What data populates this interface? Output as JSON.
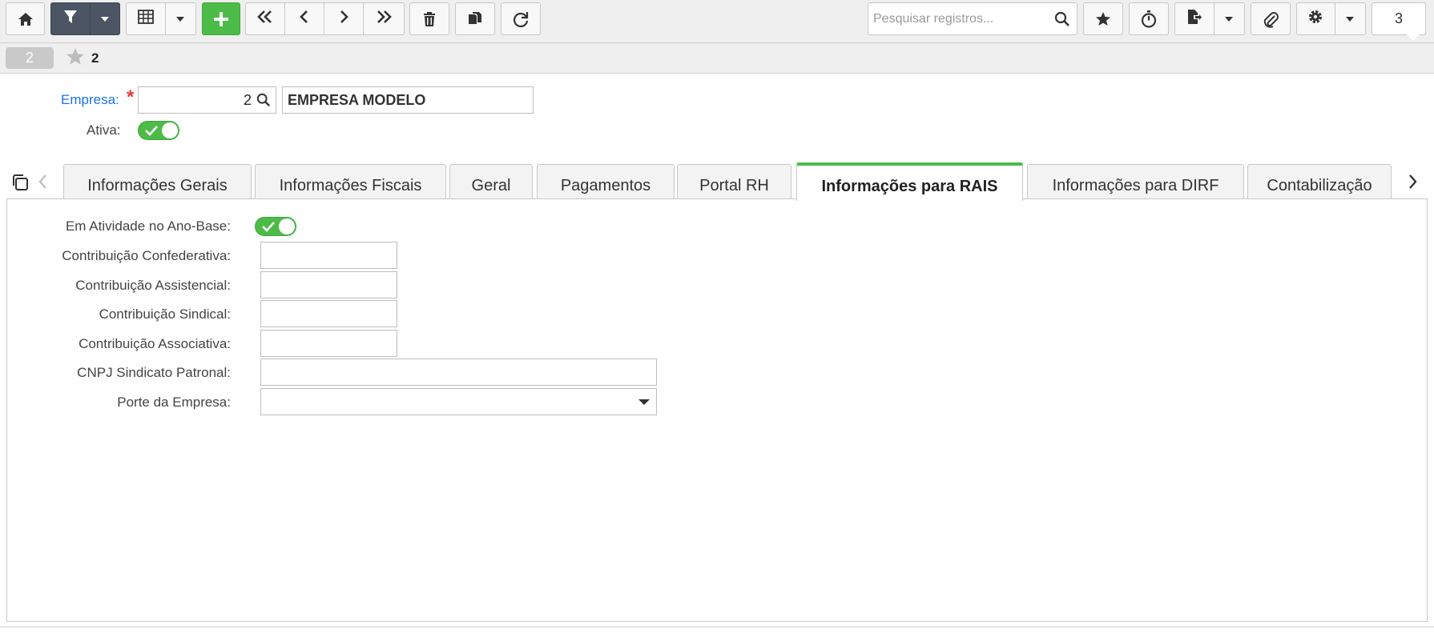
{
  "toolbar": {
    "search_placeholder": "Pesquisar registros...",
    "record_counter": "3",
    "icons": [
      "home-icon",
      "filter-icon",
      "grid-icon",
      "plus-icon",
      "first-icon",
      "prev-icon",
      "next-icon",
      "last-icon",
      "trash-icon",
      "copy-icon",
      "refresh-icon",
      "search-icon",
      "star-icon",
      "stopwatch-icon",
      "export-icon",
      "paperclip-icon",
      "gear-icon"
    ]
  },
  "breadcrumb": {
    "record_number": "2",
    "label": "2"
  },
  "header": {
    "empresa_label": "Empresa:",
    "empresa_code": "2",
    "empresa_name": "EMPRESA MODELO",
    "ativa_label": "Ativa:",
    "ativa_on": true
  },
  "tabs": [
    {
      "label": "Informações Gerais",
      "active": false
    },
    {
      "label": "Informações Fiscais",
      "active": false
    },
    {
      "label": "Geral",
      "active": false
    },
    {
      "label": "Pagamentos",
      "active": false
    },
    {
      "label": "Portal RH",
      "active": false
    },
    {
      "label": "Informações para RAIS",
      "active": true
    },
    {
      "label": "Informações para DIRF",
      "active": false
    },
    {
      "label": "Contabilização",
      "active": false
    }
  ],
  "rais": {
    "em_atividade_label": "Em Atividade no Ano-Base:",
    "em_atividade_on": true,
    "confederativa_label": "Contribuição Confederativa:",
    "confederativa_value": "",
    "assistencial_label": "Contribuição Assistencial:",
    "assistencial_value": "",
    "sindical_label": "Contribuição Sindical:",
    "sindical_value": "",
    "associativa_label": "Contribuição Associativa:",
    "associativa_value": "",
    "cnpj_label": "CNPJ Sindicato Patronal:",
    "cnpj_value": "",
    "porte_label": "Porte da Empresa:",
    "porte_value": ""
  },
  "colors": {
    "accent_green": "#4cbb47",
    "toolbar_dark": "#4b5563",
    "link_blue": "#1a73e8",
    "required_red": "#e53935"
  }
}
